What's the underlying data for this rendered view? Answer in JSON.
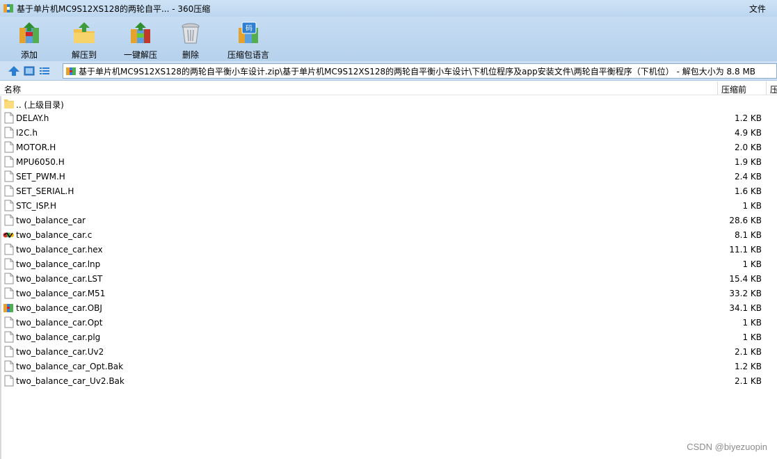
{
  "window": {
    "title": "基于单片机MC9S12XS128的两轮自平... - 360压缩",
    "menu_file": "文件"
  },
  "toolbar": {
    "items": [
      {
        "label": "添加",
        "icon": "add-archive-icon"
      },
      {
        "label": "解压到",
        "icon": "extract-to-icon"
      },
      {
        "label": "一键解压",
        "icon": "one-click-extract-icon"
      },
      {
        "label": "删除",
        "icon": "delete-icon"
      },
      {
        "label": "压缩包语言",
        "icon": "archive-language-icon"
      }
    ]
  },
  "address": {
    "path": "基于单片机MC9S12XS128的两轮自平衡小车设计.zip\\基于单片机MC9S12XS128的两轮自平衡小车设计\\下机位程序及app安装文件\\两轮自平衡程序（下机位） - 解包大小为 8.8 MB"
  },
  "columns": {
    "name": "名称",
    "compressed": "压缩前",
    "third": "压"
  },
  "files": [
    {
      "name": ".. (上级目录)",
      "size": "",
      "icon": "folder-icon"
    },
    {
      "name": "DELAY.h",
      "size": "1.2 KB",
      "icon": "file-icon"
    },
    {
      "name": "I2C.h",
      "size": "4.9 KB",
      "icon": "file-icon"
    },
    {
      "name": "MOTOR.H",
      "size": "2.0 KB",
      "icon": "file-icon"
    },
    {
      "name": "MPU6050.H",
      "size": "1.9 KB",
      "icon": "file-icon"
    },
    {
      "name": "SET_PWM.H",
      "size": "2.4 KB",
      "icon": "file-icon"
    },
    {
      "name": "SET_SERIAL.H",
      "size": "1.6 KB",
      "icon": "file-icon"
    },
    {
      "name": "STC_ISP.H",
      "size": "1 KB",
      "icon": "file-icon"
    },
    {
      "name": "two_balance_car",
      "size": "28.6 KB",
      "icon": "file-icon"
    },
    {
      "name": "two_balance_car.c",
      "size": "8.1 KB",
      "icon": "c-source-icon"
    },
    {
      "name": "two_balance_car.hex",
      "size": "11.1 KB",
      "icon": "file-icon"
    },
    {
      "name": "two_balance_car.lnp",
      "size": "1 KB",
      "icon": "file-icon"
    },
    {
      "name": "two_balance_car.LST",
      "size": "15.4 KB",
      "icon": "file-icon"
    },
    {
      "name": "two_balance_car.M51",
      "size": "33.2 KB",
      "icon": "file-icon"
    },
    {
      "name": "two_balance_car.OBJ",
      "size": "34.1 KB",
      "icon": "archive-file-icon"
    },
    {
      "name": "two_balance_car.Opt",
      "size": "1 KB",
      "icon": "file-icon"
    },
    {
      "name": "two_balance_car.plg",
      "size": "1 KB",
      "icon": "file-icon"
    },
    {
      "name": "two_balance_car.Uv2",
      "size": "2.1 KB",
      "icon": "file-icon"
    },
    {
      "name": "two_balance_car_Opt.Bak",
      "size": "1.2 KB",
      "icon": "file-icon"
    },
    {
      "name": "two_balance_car_Uv2.Bak",
      "size": "2.1 KB",
      "icon": "file-icon"
    }
  ],
  "watermark": "CSDN @biyezuopin"
}
